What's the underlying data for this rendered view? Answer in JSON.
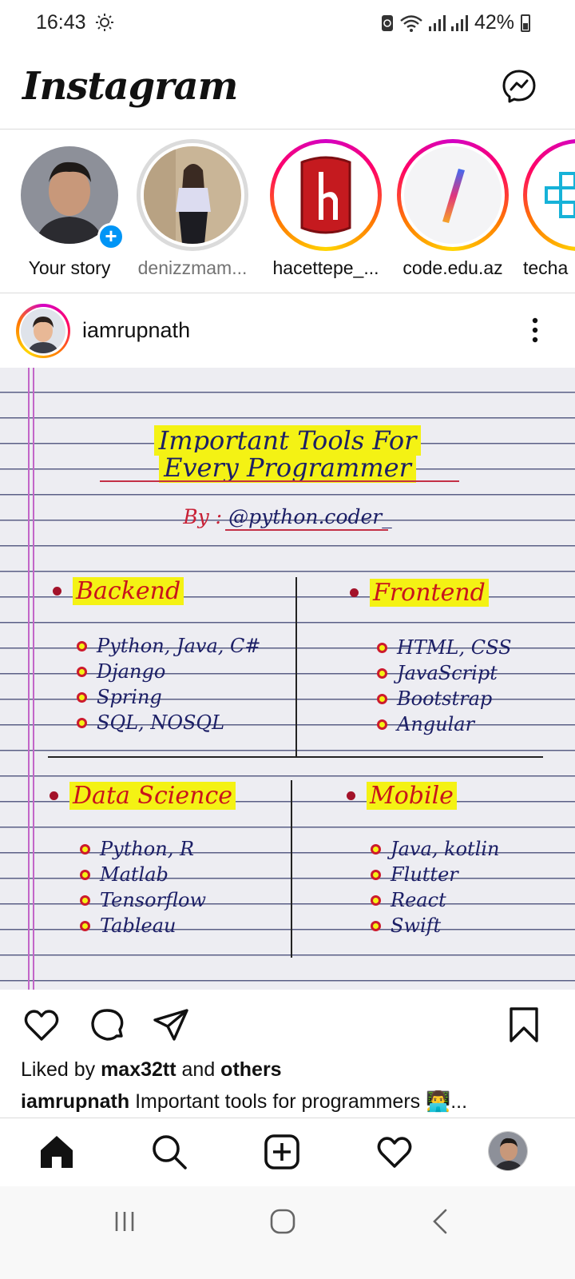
{
  "status": {
    "time": "16:43",
    "battery": "42%"
  },
  "app": {
    "title": "Instagram"
  },
  "stories": [
    {
      "label": "Your story",
      "ring": "none",
      "own": true
    },
    {
      "label": "denizzmam...",
      "ring": "seen"
    },
    {
      "label": "hacettepe_...",
      "ring": "new"
    },
    {
      "label": "code.edu.az",
      "ring": "new"
    },
    {
      "label": "techa",
      "ring": "new"
    }
  ],
  "post": {
    "username": "iamrupnath",
    "image": {
      "title_line1": "Important  Tools  For",
      "title_line2": "Every  Programmer",
      "by_label": "By :",
      "by_handle": "@python.coder_",
      "sections": [
        {
          "name": "Backend",
          "items": [
            "Python, Java, C#",
            "Django",
            "Spring",
            "SQL,  NOSQL"
          ]
        },
        {
          "name": "Frontend",
          "items": [
            "HTML, CSS",
            "JavaScript",
            "Bootstrap",
            "Angular"
          ]
        },
        {
          "name": "Data Science",
          "items": [
            "Python, R",
            "Matlab",
            "Tensorflow",
            "Tableau"
          ]
        },
        {
          "name": "Mobile",
          "items": [
            "Java, kotlin",
            "Flutter",
            "React",
            "Swift"
          ]
        }
      ]
    },
    "liked_prefix": "Liked by ",
    "liked_user": "max32tt",
    "liked_mid": " and ",
    "liked_others": "others",
    "caption_user": "iamrupnath",
    "caption_text": " Important tools for programmers 👨‍💻..."
  },
  "colors": {
    "accent": "#0095f6",
    "highlight": "#f4f214",
    "ink_blue": "#1c1f66",
    "ink_red": "#c8141c"
  },
  "icons": {
    "top_bar": [
      "messenger-icon"
    ],
    "actions": [
      "heart-icon",
      "comment-icon",
      "share-icon",
      "bookmark-icon"
    ],
    "bottom_nav": [
      "home-icon",
      "search-icon",
      "add-post-icon",
      "activity-heart-icon",
      "profile-avatar"
    ],
    "system_nav": [
      "recents-icon",
      "home-circle-icon",
      "back-icon"
    ]
  }
}
